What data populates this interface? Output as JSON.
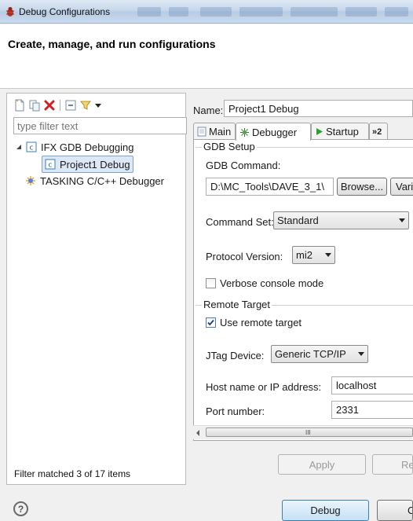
{
  "window": {
    "title": "Debug Configurations"
  },
  "header": {
    "title": "Create, manage, and run configurations"
  },
  "left": {
    "filter_placeholder": "type filter text",
    "tree": {
      "group1": "IFX GDB Debugging",
      "group1_child": "Project1 Debug",
      "group2": "TASKING C/C++ Debugger"
    },
    "status": "Filter matched 3 of 17 items"
  },
  "right": {
    "name_label": "Name:",
    "name_value": "Project1 Debug",
    "tabs": {
      "main": "Main",
      "debugger": "Debugger",
      "startup": "Startup",
      "more": "»2"
    },
    "gdb_setup": {
      "title": "GDB Setup",
      "command_label": "GDB Command:",
      "command_value": "D:\\MC_Tools\\DAVE_3_1\\",
      "browse": "Browse...",
      "variables": "Vari",
      "command_set_label": "Command Set:",
      "command_set_value": "Standard",
      "protocol_label": "Protocol Version:",
      "protocol_value": "mi2",
      "verbose_label": "Verbose console mode",
      "verbose_checked": false
    },
    "remote_target": {
      "title": "Remote Target",
      "use_remote_label": "Use remote target",
      "use_remote_checked": true,
      "jtag_label": "JTag Device:",
      "jtag_value": "Generic TCP/IP",
      "host_label": "Host name or IP address:",
      "host_value": "localhost",
      "port_label": "Port number:",
      "port_value": "2331"
    },
    "scroll_grip": "III",
    "apply": "Apply",
    "revert": "Re"
  },
  "bottom": {
    "help": "?",
    "debug": "Debug",
    "close": "C"
  },
  "colors": {
    "accent_blue": "#3c7fb1",
    "selection": "#dde8f6",
    "error_red": "#d01f1f"
  }
}
